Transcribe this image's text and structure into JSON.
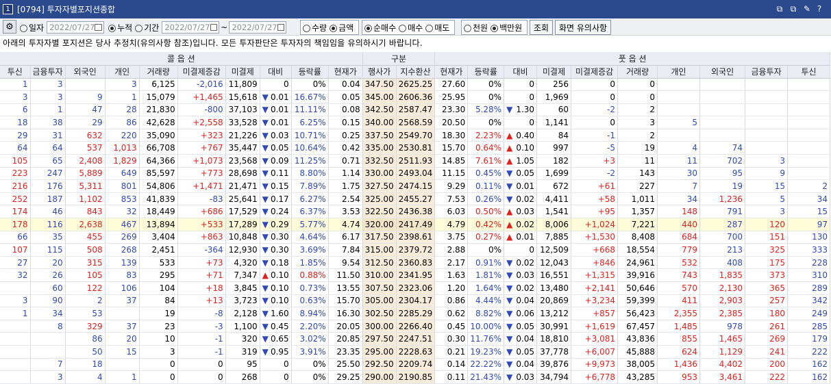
{
  "window": {
    "num": "1",
    "title": "[0794] 투자자별포지션종합",
    "controls": [
      "⧉",
      "⧉",
      "✎",
      "?",
      "—",
      "▭"
    ]
  },
  "toolbar": {
    "gear": "⚙",
    "mode": [
      {
        "label": "일자",
        "on": false
      },
      {
        "label": "누적",
        "on": true
      },
      {
        "label": "기간",
        "on": false
      }
    ],
    "date1": "2022/07/27",
    "date2": "2022/07/27",
    "tilde": "~",
    "date3": "2022/07/27",
    "measure": [
      {
        "label": "수량",
        "on": false
      },
      {
        "label": "금액",
        "on": true
      }
    ],
    "trade": [
      {
        "label": "순매수",
        "on": true
      },
      {
        "label": "매수",
        "on": false
      },
      {
        "label": "매도",
        "on": false
      }
    ],
    "unit": [
      {
        "label": "천원",
        "on": false
      },
      {
        "label": "백만원",
        "on": true
      }
    ],
    "query_btn": "조회",
    "notice_btn": "화면 유의사항"
  },
  "notice": "아래의 투자자별 포지션은 당사 추정치(유의사항 참조)입니다. 모든 투자판단은 투자자의 책임임을 유의하시기 바랍니다.",
  "headers": {
    "call": "콜 옵 션",
    "mid": "구분",
    "put": "풋 옵 션"
  },
  "columns": [
    "투신",
    "금융투자",
    "외국인",
    "개인",
    "거래량",
    "미결제증감",
    "미결제",
    "대비",
    "등락률",
    "현재가",
    "행사가",
    "지수환산",
    "현재가",
    "등락률",
    "대비",
    "미결제",
    "미결제증감",
    "거래량",
    "개인",
    "외국인",
    "금융투자",
    "투신"
  ],
  "rows": [
    [
      "1",
      "3",
      "",
      "3",
      "6,125",
      "-2,016",
      "11,809",
      "0",
      "0%",
      "0.04",
      "347.50",
      "2625.25",
      "27.60",
      "0%",
      "0",
      "256",
      "0",
      "0",
      "",
      "",
      "",
      ""
    ],
    [
      "3",
      "3",
      "9",
      "1",
      "15,079",
      "+1,465",
      "15,618",
      "▼ 0.01",
      "16.67%",
      "0.05",
      "345.00",
      "2606.36",
      "25.95",
      "0%",
      "0",
      "1,969",
      "0",
      "0",
      "",
      "",
      "",
      ""
    ],
    [
      "6",
      "1",
      "47",
      "28",
      "21,830",
      "-800",
      "37,103",
      "▼ 0.01",
      "11.11%",
      "0.08",
      "342.50",
      "2587.47",
      "23.30",
      "5.28%",
      "▼ 1.30",
      "60",
      "-2",
      "2",
      "",
      "",
      "",
      ""
    ],
    [
      "18",
      "38",
      "29",
      "86",
      "42,628",
      "+2,558",
      "33,528",
      "▼ 0.01",
      "6.25%",
      "0.15",
      "340.00",
      "2568.59",
      "20.50",
      "0%",
      "0",
      "1,141",
      "0",
      "3",
      "5",
      "",
      "",
      ""
    ],
    [
      "29",
      "31",
      "632",
      "220",
      "35,090",
      "+323",
      "21,226",
      "▼ 0.03",
      "10.71%",
      "0.25",
      "337.50",
      "2549.70",
      "18.30",
      "2.23%",
      "▲ 0.40",
      "84",
      "-1",
      "2",
      "",
      "",
      "",
      ""
    ],
    [
      "64",
      "64",
      "537",
      "1,013",
      "66,708",
      "+767",
      "35,447",
      "▼ 0.05",
      "10.64%",
      "0.42",
      "335.00",
      "2530.81",
      "15.70",
      "0.64%",
      "▲ 0.10",
      "997",
      "-5",
      "19",
      "4",
      "74",
      "",
      ""
    ],
    [
      "105",
      "65",
      "2,408",
      "1,829",
      "64,366",
      "+1,073",
      "23,568",
      "▼ 0.09",
      "11.25%",
      "0.71",
      "332.50",
      "2511.93",
      "14.85",
      "7.61%",
      "▲ 1.05",
      "182",
      "+3",
      "11",
      "11",
      "702",
      "3",
      ""
    ],
    [
      "223",
      "247",
      "5,889",
      "649",
      "85,597",
      "+773",
      "28,698",
      "▼ 0.11",
      "8.80%",
      "1.14",
      "330.00",
      "2493.04",
      "11.15",
      "0.45%",
      "▼ 0.05",
      "1,699",
      "-2",
      "143",
      "30",
      "95",
      "9",
      ""
    ],
    [
      "216",
      "176",
      "5,311",
      "801",
      "54,806",
      "+1,471",
      "21,471",
      "▼ 0.15",
      "7.89%",
      "1.75",
      "327.50",
      "2474.15",
      "9.29",
      "0.11%",
      "▼ 0.01",
      "672",
      "+61",
      "227",
      "7",
      "19",
      "15",
      "2"
    ],
    [
      "252",
      "187",
      "1,102",
      "853",
      "41,839",
      "-83",
      "25,641",
      "▼ 0.17",
      "6.27%",
      "2.54",
      "325.00",
      "2455.27",
      "7.53",
      "0.26%",
      "▼ 0.02",
      "4,411",
      "+58",
      "1,011",
      "34",
      "1,236",
      "5",
      "34"
    ],
    [
      "174",
      "46",
      "843",
      "32",
      "18,449",
      "+686",
      "17,529",
      "▼ 0.24",
      "6.37%",
      "3.53",
      "322.50",
      "2436.38",
      "6.03",
      "0.50%",
      "▲ 0.03",
      "1,541",
      "+95",
      "1,357",
      "148",
      "791",
      "3",
      "15"
    ],
    [
      "178",
      "116",
      "2,638",
      "467",
      "13,894",
      "+533",
      "17,289",
      "▼ 0.29",
      "5.77%",
      "4.74",
      "320.00",
      "2417.49",
      "4.79",
      "0.42%",
      "▲ 0.02",
      "8,006",
      "+1,024",
      "7,221",
      "440",
      "287",
      "120",
      "97"
    ],
    [
      "66",
      "35",
      "455",
      "269",
      "3,404",
      "+863",
      "10,848",
      "▼ 0.30",
      "4.64%",
      "6.17",
      "317.50",
      "2398.61",
      "3.75",
      "0.27%",
      "▲ 0.01",
      "7,885",
      "+1,530",
      "8,408",
      "684",
      "700",
      "151",
      "130"
    ],
    [
      "107",
      "115",
      "508",
      "268",
      "2,451",
      "-364",
      "12,930",
      "▼ 0.30",
      "3.69%",
      "7.84",
      "315.00",
      "2379.72",
      "2.88",
      "0%",
      "0",
      "12,509",
      "+668",
      "18,554",
      "779",
      "213",
      "325",
      "333"
    ],
    [
      "27",
      "20",
      "315",
      "139",
      "533",
      "+73",
      "4,320",
      "▼ 0.18",
      "1.85%",
      "9.54",
      "312.50",
      "2360.83",
      "2.17",
      "0.91%",
      "▼ 0.02",
      "12,043",
      "+846",
      "24,961",
      "532",
      "408",
      "175",
      "228"
    ],
    [
      "32",
      "26",
      "105",
      "83",
      "295",
      "+71",
      "7,347",
      "▲ 0.10",
      "0.88%",
      "11.50",
      "310.00",
      "2341.95",
      "1.63",
      "1.81%",
      "▼ 0.03",
      "16,551",
      "+1,315",
      "39,916",
      "743",
      "1,835",
      "373",
      "310"
    ],
    [
      "",
      "60",
      "122",
      "106",
      "104",
      "+18",
      "3,845",
      "▼ 0.10",
      "0.73%",
      "13.55",
      "307.50",
      "2323.06",
      "1.20",
      "1.64%",
      "▼ 0.02",
      "13,480",
      "+2,141",
      "50,646",
      "570",
      "2,130",
      "365",
      "289"
    ],
    [
      "3",
      "90",
      "2",
      "37",
      "84",
      "+13",
      "3,723",
      "▼ 0.10",
      "0.63%",
      "15.70",
      "305.00",
      "2304.17",
      "0.86",
      "4.44%",
      "▼ 0.04",
      "20,869",
      "+3,234",
      "59,399",
      "411",
      "2,903",
      "257",
      "342"
    ],
    [
      "1",
      "34",
      "53",
      "",
      "19",
      "-8",
      "2,128",
      "▼ 1.60",
      "8.94%",
      "16.30",
      "302.50",
      "2285.29",
      "0.62",
      "8.82%",
      "▼ 0.06",
      "13,212",
      "+857",
      "56,423",
      "2,355",
      "2,385",
      "180",
      "249"
    ],
    [
      "",
      "8",
      "329",
      "37",
      "23",
      "-3",
      "1,100",
      "▼ 0.45",
      "2.20%",
      "20.05",
      "300.00",
      "2266.40",
      "0.45",
      "10.00%",
      "▼ 0.05",
      "30,991",
      "+1,619",
      "67,457",
      "1,485",
      "978",
      "261",
      "285"
    ],
    [
      "",
      "",
      "86",
      "20",
      "10",
      "-1",
      "320",
      "▼ 0.65",
      "3.02%",
      "20.85",
      "297.50",
      "2247.51",
      "0.30",
      "11.76%",
      "▼ 0.04",
      "18,810",
      "+3,081",
      "43,836",
      "855",
      "1,465",
      "269",
      "179"
    ],
    [
      "",
      "",
      "50",
      "15",
      "3",
      "-1",
      "319",
      "▼ 0.95",
      "3.91%",
      "23.35",
      "295.00",
      "2228.63",
      "0.21",
      "19.23%",
      "▼ 0.05",
      "37,778",
      "+6,007",
      "45,888",
      "624",
      "1,129",
      "241",
      "222"
    ],
    [
      "",
      "7",
      "18",
      "",
      "0",
      "0",
      "95",
      "0",
      "0%",
      "25.50",
      "292.50",
      "2209.74",
      "0.14",
      "22.22%",
      "▼ 0.04",
      "39,876",
      "+9,973",
      "38,005",
      "1,436",
      "4,402",
      "200",
      "162"
    ],
    [
      "",
      "3",
      "4",
      "1",
      "0",
      "0",
      "268",
      "0",
      "0%",
      "29.25",
      "290.00",
      "2190.85",
      "0.11",
      "21.43%",
      "▼ 0.03",
      "34,794",
      "+6,778",
      "43,285",
      "953",
      "3,461",
      "222",
      "162"
    ]
  ],
  "highlight_row": 11,
  "colors": {
    "title_bg": "#2b4a8e",
    "red": "#e0211d",
    "blue": "#2f4ab8",
    "strike_bg": "#f6ecd9",
    "highlight": "#fdfbd8"
  }
}
